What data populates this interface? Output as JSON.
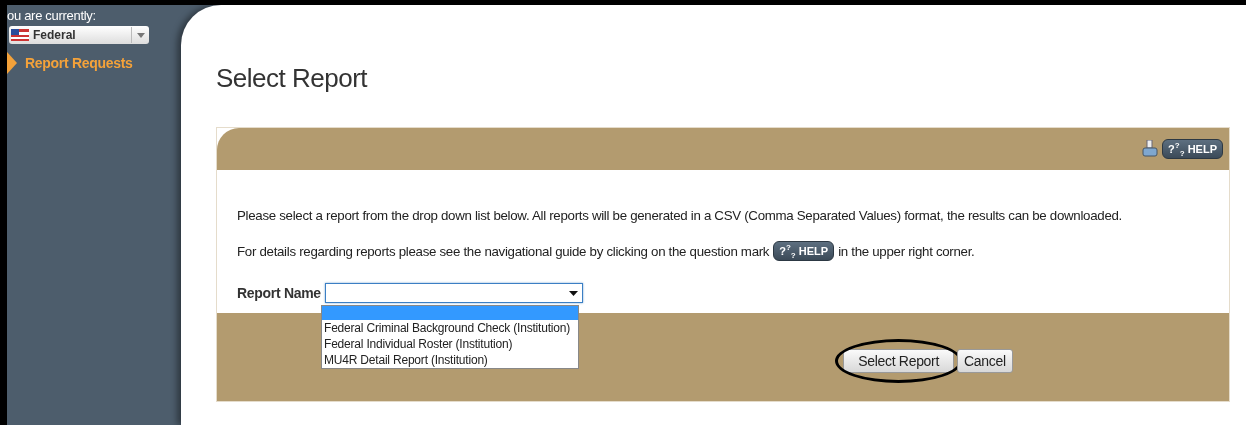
{
  "sidebar": {
    "context_label": "ou are currently:",
    "context_select": {
      "value": "Federal"
    },
    "items": [
      {
        "label": "Report Requests",
        "selected": true
      }
    ]
  },
  "page": {
    "title": "Select Report"
  },
  "panel": {
    "help_button": "?$^{?}$$_{?}$ HELP",
    "paragraphs": [
      {
        "text": "Please select a report from the drop down list below. All reports will be generated in a CSV (Comma Separated Values) format, the results can be downloaded."
      },
      {
        "before": "For details regarding reports please see the navigational guide by clicking on the question mark",
        "help_button": "?$^{?}$$_{?}$ HELP",
        "after": "in the upper right corner."
      }
    ],
    "report_field": {
      "label": "Report Name",
      "expanded": true,
      "blank_highlighted": true,
      "options": [
        {
          "label": "Federal Criminal Background Check (Institution)",
          "selected": false
        },
        {
          "label": "Federal Individual Roster (Institution)",
          "selected": false
        },
        {
          "label": "MU4R Detail Report (Institution)",
          "selected": false
        }
      ]
    },
    "buttons": [
      {
        "label": "Select Report",
        "circled": true
      },
      {
        "label": "Cancel",
        "circled": false
      }
    ]
  }
}
